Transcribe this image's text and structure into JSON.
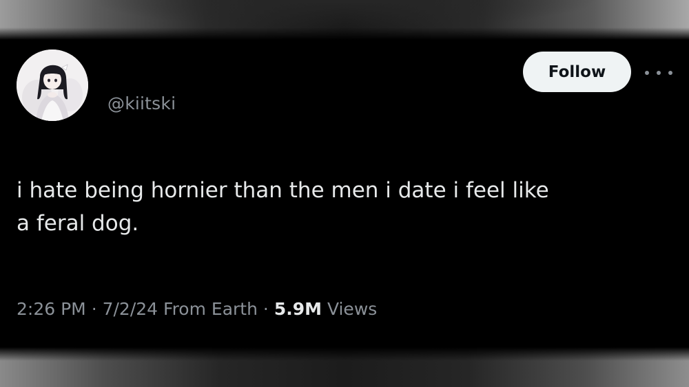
{
  "tweet": {
    "handle": "@kiitski",
    "follow_label": "Follow",
    "more_icon": "more-horizontal-icon",
    "text": "i hate being hornier than the men i date i feel like\na feral dog.",
    "time": "2:26 PM",
    "separator": "·",
    "date": "7/2/24",
    "source": "From Earth",
    "views_count": "5.9M",
    "views_label": "Views"
  },
  "colors": {
    "background": "#000000",
    "text_primary": "#e7e9ea",
    "text_secondary": "#8b9198",
    "follow_bg": "#eff3f4",
    "follow_text": "#0f1419"
  }
}
